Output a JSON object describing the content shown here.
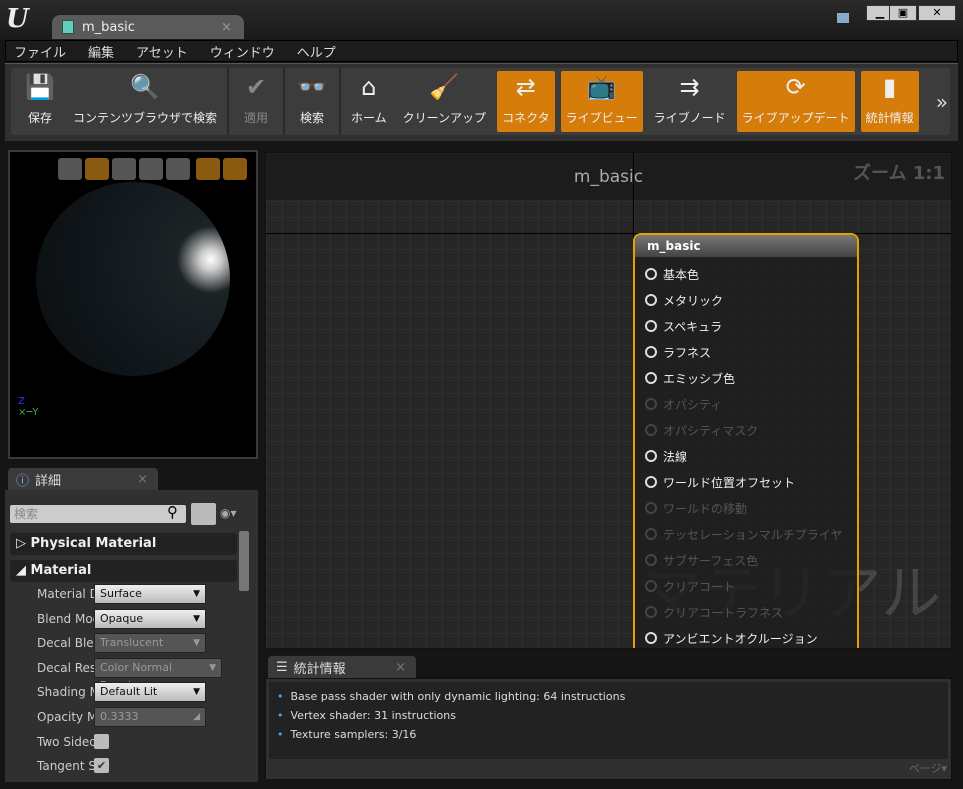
{
  "window": {
    "tab_title": "m_basic",
    "logo": "U"
  },
  "menu": [
    "ファイル",
    "編集",
    "アセット",
    "ウィンドウ",
    "ヘルプ"
  ],
  "toolbar": [
    {
      "label": "保存",
      "icon": "floppy-icon",
      "active": false,
      "disabled": false
    },
    {
      "label": "コンテンツブラウザで検索",
      "icon": "magnifier-icon",
      "active": false,
      "disabled": false
    },
    {
      "label": "適用",
      "icon": "checkmark-icon",
      "active": false,
      "disabled": true
    },
    {
      "label": "検索",
      "icon": "binoculars-icon",
      "active": false,
      "disabled": false
    },
    {
      "label": "ホーム",
      "icon": "home-icon",
      "active": false,
      "disabled": false
    },
    {
      "label": "クリーンアップ",
      "icon": "broom-icon",
      "active": false,
      "disabled": false
    },
    {
      "label": "コネクタ",
      "icon": "connector-icon",
      "active": true,
      "disabled": false
    },
    {
      "label": "ライブビュー",
      "icon": "tv-icon",
      "active": true,
      "disabled": false
    },
    {
      "label": "ライブノード",
      "icon": "live-nodes-icon",
      "active": false,
      "disabled": false
    },
    {
      "label": "ライブアップデート",
      "icon": "live-update-icon",
      "active": true,
      "disabled": false
    },
    {
      "label": "統計情報",
      "icon": "stats-icon",
      "active": true,
      "disabled": false
    }
  ],
  "details": {
    "tab": "詳細",
    "search_placeholder": "検索",
    "categories": [
      "Physical Material",
      "Material"
    ],
    "properties": [
      {
        "label": "Material Domain",
        "value": "Surface",
        "type": "dropdown",
        "disabled": false
      },
      {
        "label": "Blend Mode",
        "value": "Opaque",
        "type": "dropdown",
        "disabled": false
      },
      {
        "label": "Decal Blend Mode",
        "value": "Translucent",
        "type": "dropdown",
        "disabled": true
      },
      {
        "label": "Decal Response",
        "value": "Color Normal Roughness",
        "type": "dropdown",
        "disabled": true
      },
      {
        "label": "Shading Model",
        "value": "Default Lit",
        "type": "dropdown",
        "disabled": false
      },
      {
        "label": "Opacity Mask Clip Value",
        "value": "0.3333",
        "type": "number",
        "disabled": true
      },
      {
        "label": "Two Sided",
        "value": false,
        "type": "checkbox"
      },
      {
        "label": "Tangent Space Normal",
        "value": true,
        "type": "checkbox"
      }
    ]
  },
  "graph": {
    "title": "m_basic",
    "zoom": "ズーム 1:1",
    "watermark": "マテリアル",
    "node": {
      "title": "m_basic",
      "pins": [
        {
          "label": "基本色",
          "enabled": true
        },
        {
          "label": "メタリック",
          "enabled": true
        },
        {
          "label": "スペキュラ",
          "enabled": true
        },
        {
          "label": "ラフネス",
          "enabled": true
        },
        {
          "label": "エミッシブ色",
          "enabled": true
        },
        {
          "label": "オパシティ",
          "enabled": false
        },
        {
          "label": "オパシティマスク",
          "enabled": false
        },
        {
          "label": "法線",
          "enabled": true
        },
        {
          "label": "ワールド位置オフセット",
          "enabled": true
        },
        {
          "label": "ワールドの移動",
          "enabled": false
        },
        {
          "label": "テッセレーションマルチプライヤ",
          "enabled": false
        },
        {
          "label": "サブサーフェス色",
          "enabled": false
        },
        {
          "label": "クリアコート",
          "enabled": false
        },
        {
          "label": "クリアコートラフネス",
          "enabled": false
        },
        {
          "label": "アンビエントオクルージョン",
          "enabled": true
        }
      ]
    }
  },
  "stats": {
    "tab": "統計情報",
    "lines": [
      "Base pass shader with only dynamic lighting: 64 instructions",
      "Vertex shader: 31 instructions",
      "Texture samplers: 3/16"
    ],
    "page": "ページ▾"
  },
  "colors": {
    "accent": "#d67c0b",
    "node_border": "#e5a000"
  }
}
